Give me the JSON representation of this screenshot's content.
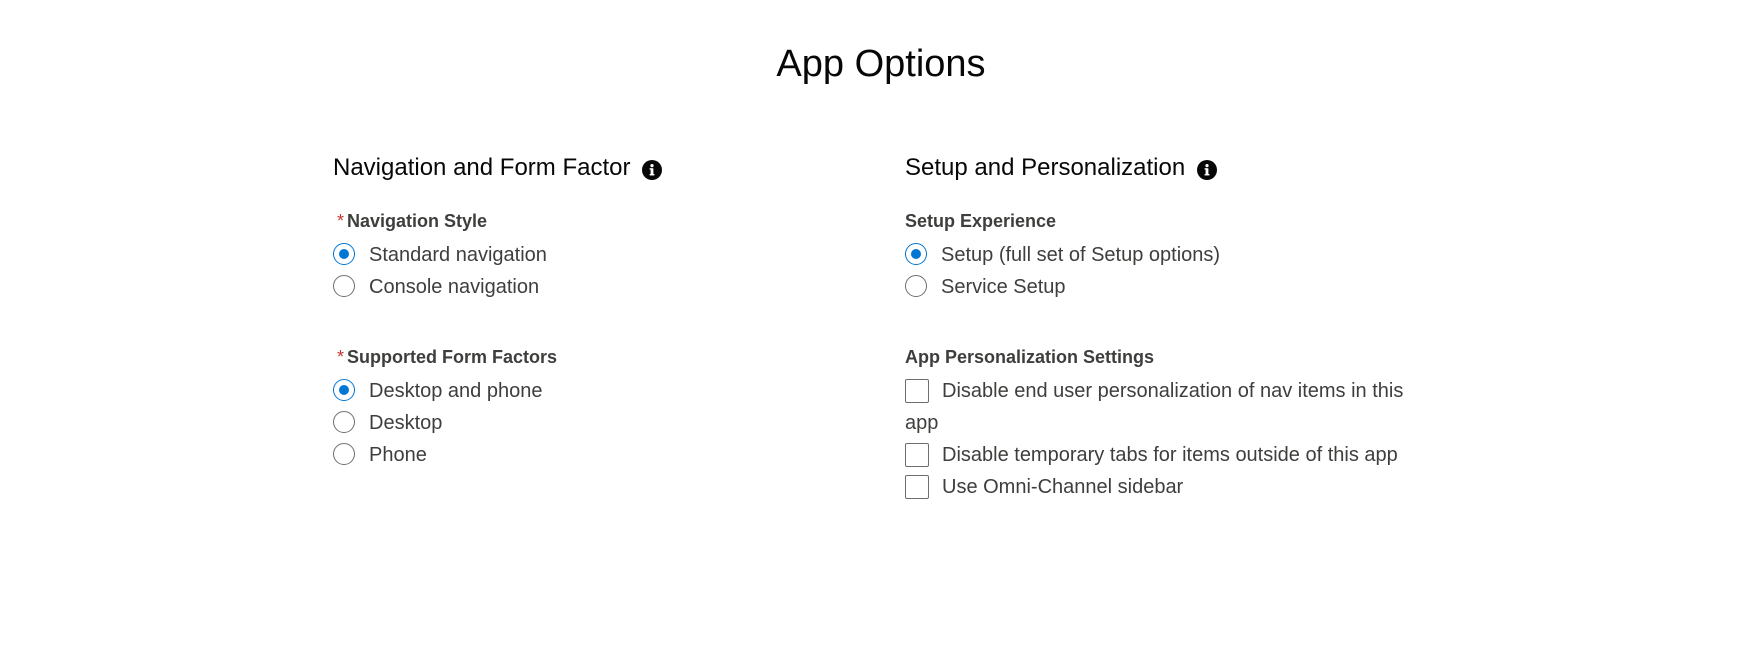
{
  "page": {
    "title": "App Options"
  },
  "navigation_section": {
    "heading": "Navigation and Form Factor",
    "info_icon": "info-icon",
    "navigation_style": {
      "label": "Navigation Style",
      "required": "*",
      "options": [
        {
          "label": "Standard navigation",
          "checked": true
        },
        {
          "label": "Console navigation",
          "checked": false
        }
      ]
    },
    "form_factors": {
      "label": "Supported Form Factors",
      "required": "*",
      "options": [
        {
          "label": "Desktop and phone",
          "checked": true
        },
        {
          "label": "Desktop",
          "checked": false
        },
        {
          "label": "Phone",
          "checked": false
        }
      ]
    }
  },
  "setup_section": {
    "heading": "Setup and Personalization",
    "info_icon": "info-icon",
    "setup_experience": {
      "label": "Setup Experience",
      "options": [
        {
          "label": "Setup (full set of Setup options)",
          "checked": true
        },
        {
          "label": "Service Setup",
          "checked": false
        }
      ]
    },
    "personalization": {
      "label": "App Personalization Settings",
      "options": [
        {
          "label": "Disable end user personalization of nav items in this app",
          "checked": false
        },
        {
          "label": "Disable temporary tabs for items outside of this app",
          "checked": false
        },
        {
          "label": "Use Omni-Channel sidebar",
          "checked": false
        }
      ]
    }
  },
  "colors": {
    "accent": "#0176d3",
    "required": "#c23934",
    "text": "#3e3e3c",
    "heading": "#080707"
  }
}
